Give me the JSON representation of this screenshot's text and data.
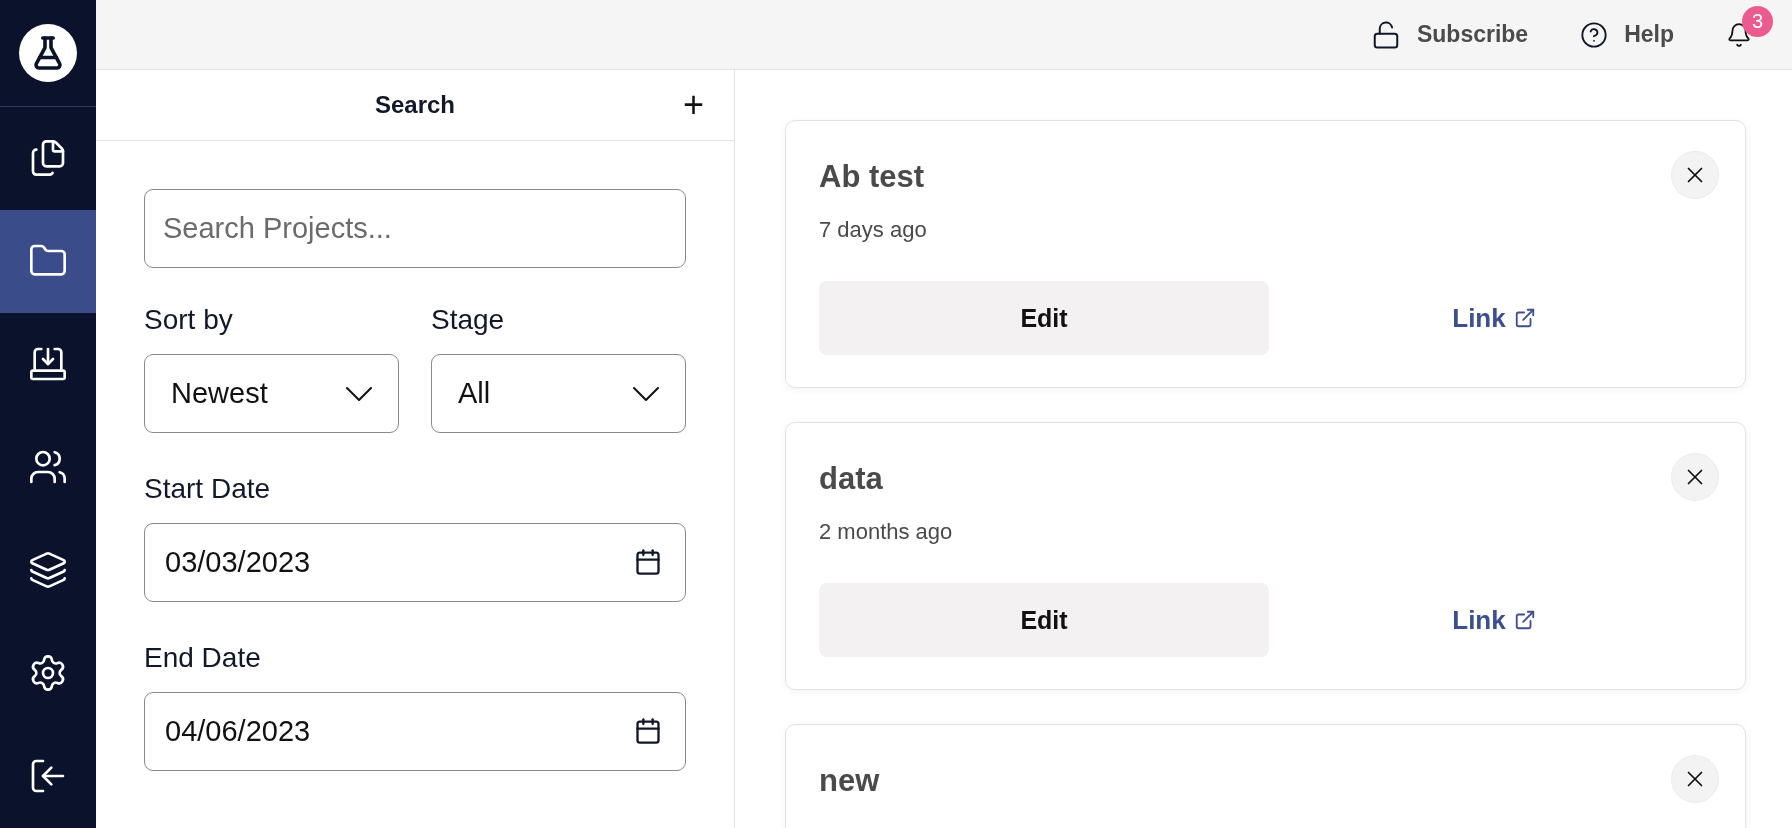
{
  "sidebar": {
    "items": [
      {
        "kind": "clipboard",
        "selected": false
      },
      {
        "kind": "folder",
        "selected": true
      },
      {
        "kind": "inbox",
        "selected": false
      },
      {
        "kind": "users",
        "selected": false
      },
      {
        "kind": "layers",
        "selected": false
      },
      {
        "kind": "settings",
        "selected": false
      },
      {
        "kind": "logout",
        "selected": false
      }
    ]
  },
  "topbar": {
    "subscribe": "Subscribe",
    "help": "Help",
    "notifications": "3"
  },
  "search_panel": {
    "title": "Search",
    "add": "+",
    "search": {
      "placeholder": "Search Projects..."
    },
    "sort_by": {
      "label": "Sort by",
      "value": "Newest"
    },
    "stage": {
      "label": "Stage",
      "value": "All"
    },
    "start_date": {
      "label": "Start Date",
      "value": "03/03/2023"
    },
    "end_date": {
      "label": "End Date",
      "value": "04/06/2023"
    }
  },
  "projects": [
    {
      "title": "Ab test",
      "age": "7 days ago",
      "edit": "Edit",
      "link": "Link"
    },
    {
      "title": "data",
      "age": "2 months ago",
      "edit": "Edit",
      "link": "Link"
    },
    {
      "title": "new"
    }
  ]
}
